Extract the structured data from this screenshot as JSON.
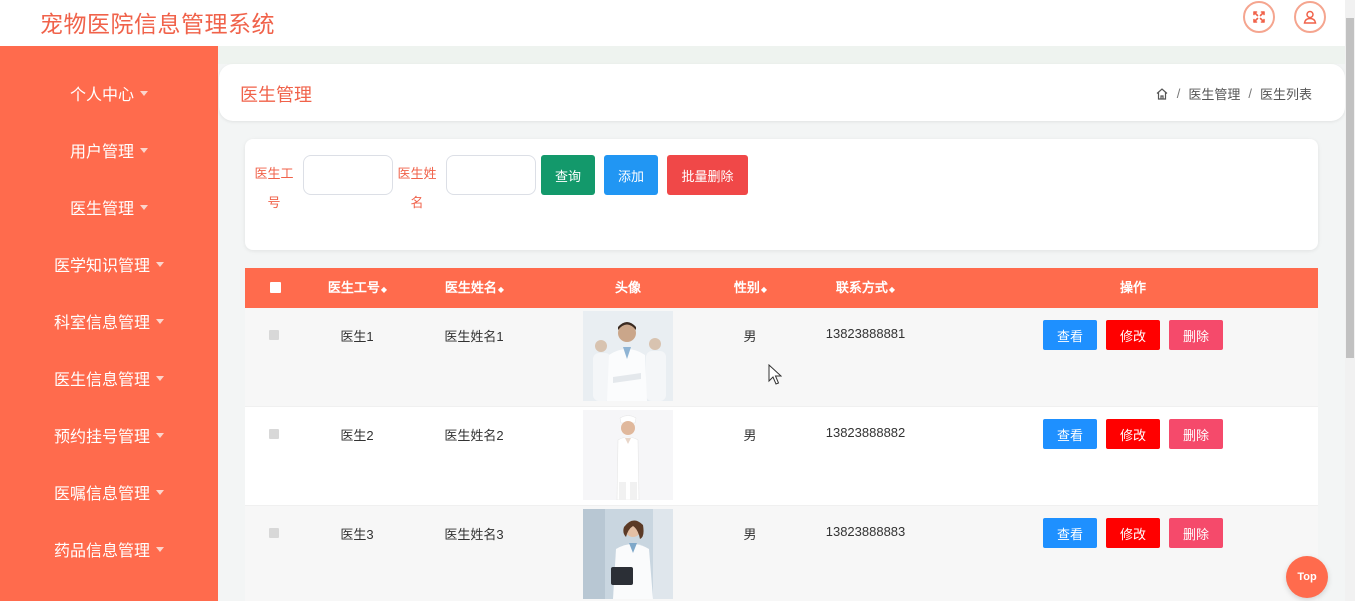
{
  "app": {
    "title": "宠物医院信息管理系统"
  },
  "topbar": {
    "fullscreen_icon": "fullscreen-icon",
    "user_icon": "user-icon"
  },
  "sidebar": {
    "items": [
      {
        "label": "个人中心"
      },
      {
        "label": "用户管理"
      },
      {
        "label": "医生管理"
      },
      {
        "label": "医学知识管理"
      },
      {
        "label": "科室信息管理"
      },
      {
        "label": "医生信息管理"
      },
      {
        "label": "预约挂号管理"
      },
      {
        "label": "医嘱信息管理"
      },
      {
        "label": "药品信息管理"
      }
    ]
  },
  "header": {
    "title": "医生管理",
    "breadcrumb": [
      "医生管理",
      "医生列表"
    ]
  },
  "search": {
    "field1_label_a": "医生工",
    "field1_label_b": "号",
    "field2_label_a": "医生姓",
    "field2_label_b": "名",
    "field1_value": "",
    "field2_value": "",
    "query_label": "查询",
    "add_label": "添加",
    "batch_delete_label": "批量删除"
  },
  "table": {
    "columns": [
      "医生工号",
      "医生姓名",
      "头像",
      "性别",
      "联系方式",
      "操作"
    ],
    "sort_mark": "◆",
    "rows": [
      {
        "id": "医生1",
        "name": "医生姓名1",
        "gender": "男",
        "phone": "13823888881"
      },
      {
        "id": "医生2",
        "name": "医生姓名2",
        "gender": "男",
        "phone": "13823888882"
      },
      {
        "id": "医生3",
        "name": "医生姓名3",
        "gender": "男",
        "phone": "13823888883"
      }
    ],
    "actions": {
      "view": "查看",
      "edit": "修改",
      "delete": "删除"
    }
  },
  "back_to_top": {
    "label": "Top"
  },
  "colors": {
    "primary": "#ff6b4d",
    "title": "#f0624a",
    "query": "#13996b",
    "add": "#2196f3",
    "batch_delete": "#f04848",
    "view": "#1e90ff",
    "edit": "#ff0000",
    "delete": "#f54a6b"
  }
}
